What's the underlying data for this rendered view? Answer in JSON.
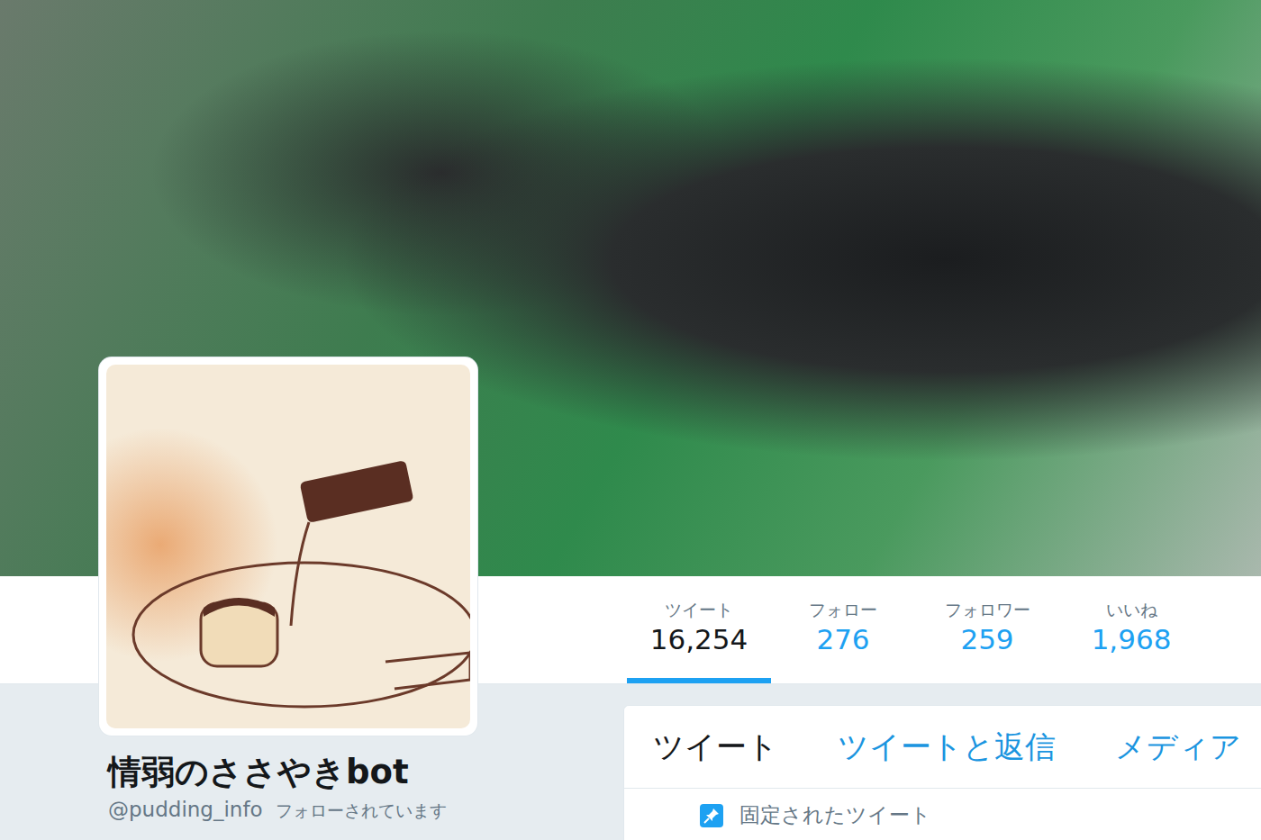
{
  "profile": {
    "name": "情弱のささやきbot",
    "handle": "@pudding_info",
    "follows_you": "フォローされています"
  },
  "stats": [
    {
      "label": "ツイート",
      "value": "16,254",
      "selected": true
    },
    {
      "label": "フォロー",
      "value": "276",
      "selected": false
    },
    {
      "label": "フォロワー",
      "value": "259",
      "selected": false
    },
    {
      "label": "いいね",
      "value": "1,968",
      "selected": false
    }
  ],
  "tabs": [
    {
      "label": "ツイート",
      "selected": true
    },
    {
      "label": "ツイートと返信",
      "selected": false
    },
    {
      "label": "メディア",
      "selected": false
    }
  ],
  "pinned": {
    "label": "固定されたツイート"
  }
}
